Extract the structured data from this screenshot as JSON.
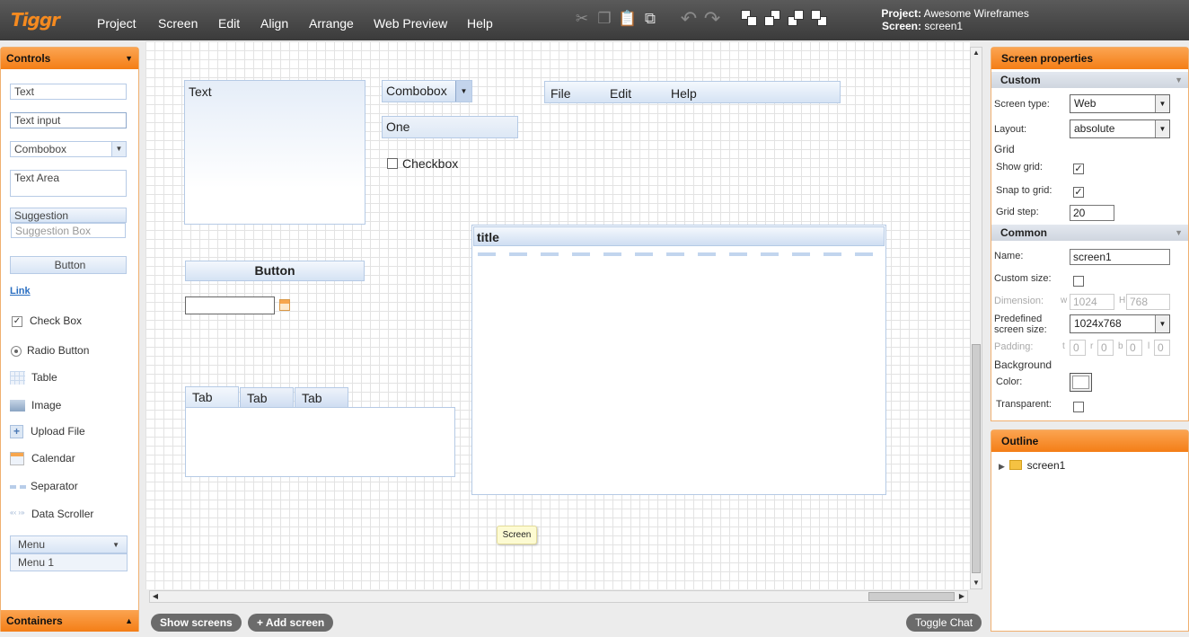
{
  "app": {
    "logo": "Tiggr"
  },
  "menubar": {
    "items": [
      "Project",
      "Screen",
      "Edit",
      "Align",
      "Arrange",
      "Web Preview",
      "Help"
    ]
  },
  "toolbar": {
    "icons": [
      "cut-icon",
      "copy-icon",
      "paste-icon",
      "duplicate-icon",
      "undo-icon",
      "redo-icon",
      "bring-front-icon",
      "bring-forward-icon",
      "send-backward-icon",
      "send-back-icon"
    ]
  },
  "project_info": {
    "project_label": "Project:",
    "project_value": "Awesome Wireframes",
    "screen_label": "Screen:",
    "screen_value": "screen1"
  },
  "controls": {
    "header": "Controls",
    "items": {
      "text": "Text",
      "text_input": "Text input",
      "combobox": "Combobox",
      "text_area": "Text Area",
      "suggestion": "Suggestion",
      "suggestion_box": "Suggestion Box",
      "button": "Button",
      "link": "Link",
      "check_box": "Check Box",
      "radio_button": "Radio Button",
      "table": "Table",
      "image": "Image",
      "upload_file": "Upload File",
      "calendar": "Calendar",
      "separator": "Separator",
      "data_scroller": "Data Scroller",
      "menu": "Menu",
      "menu_1": "Menu 1"
    },
    "containers_header": "Containers"
  },
  "canvas": {
    "text_area": "Text",
    "combobox": "Combobox",
    "list_value": "One",
    "checkbox": "Checkbox",
    "menubar": [
      "File",
      "Edit",
      "Help"
    ],
    "button": "Button",
    "tabs": [
      "Tab",
      "Tab",
      "Tab"
    ],
    "panel_title": "title",
    "tooltip": "Screen"
  },
  "bottom": {
    "show_screens": "Show screens",
    "add_screen": "+ Add screen",
    "toggle_chat": "Toggle Chat"
  },
  "screen_properties": {
    "header": "Screen properties",
    "custom_header": "Custom",
    "screen_type_label": "Screen type:",
    "screen_type": "Web",
    "layout_label": "Layout:",
    "layout": "absolute",
    "grid_label": "Grid",
    "show_grid_label": "Show grid:",
    "show_grid": true,
    "snap_grid_label": "Snap to grid:",
    "snap_grid": true,
    "grid_step_label": "Grid step:",
    "grid_step": "20",
    "common_header": "Common",
    "name_label": "Name:",
    "name": "screen1",
    "custom_size_label": "Custom size:",
    "custom_size": false,
    "dimension_label": "Dimension:",
    "w_label": "w",
    "width": "1024",
    "h_label": "H",
    "height": "768",
    "predefined_label_1": "Predefined",
    "predefined_label_2": "screen size:",
    "predefined": "1024x768",
    "padding_label": "Padding:",
    "pad_t_label": "t",
    "pad_r_label": "r",
    "pad_b_label": "b",
    "pad_l_label": "l",
    "pad_t": "0",
    "pad_r": "0",
    "pad_b": "0",
    "pad_l": "0",
    "background_label": "Background",
    "color_label": "Color:",
    "transparent_label": "Transparent:",
    "transparent": false
  },
  "outline": {
    "header": "Outline",
    "root": "screen1"
  },
  "colors": {
    "accent": "#f47e16",
    "topbar": "#3b3b3b",
    "widget_blue": "#d5e3f4"
  }
}
